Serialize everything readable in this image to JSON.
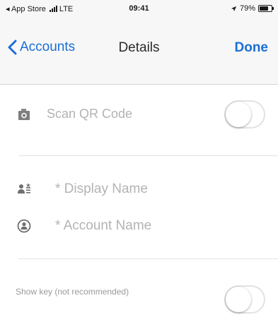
{
  "status_bar": {
    "carrier_back": "◂ App Store",
    "network": "LTE",
    "time": "09:41",
    "battery_percent": "79%",
    "battery_level": 0.79
  },
  "nav": {
    "back_label": "Accounts",
    "title": "Details",
    "done_label": "Done"
  },
  "scan": {
    "label": "Scan QR Code",
    "icon": "camera-icon",
    "enabled": false
  },
  "fields": {
    "display_name_placeholder": "* Display Name",
    "display_name_icon": "contact-card-icon",
    "account_name_placeholder": "* Account Name",
    "account_name_icon": "user-circle-icon"
  },
  "show_key": {
    "label": "Show key (not recommended)",
    "enabled": false
  },
  "colors": {
    "accent": "#1a6fd6",
    "placeholder": "#b3b3b3",
    "nav_background": "#f7f7f7"
  }
}
